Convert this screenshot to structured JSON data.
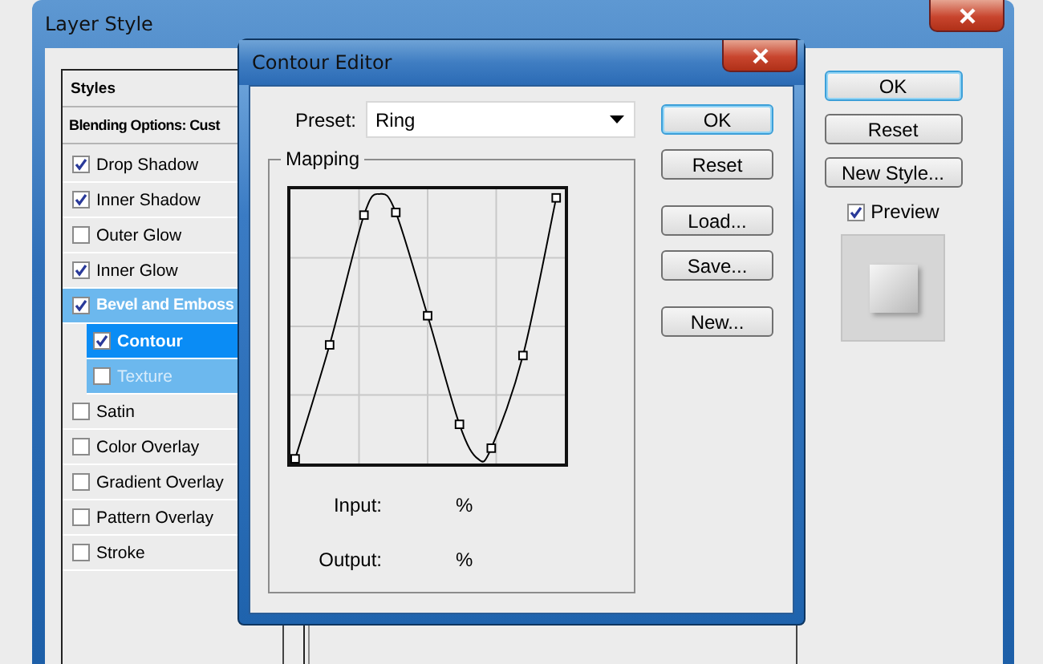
{
  "layer_style": {
    "title": "Layer Style",
    "styles_header": "Styles",
    "blending_options": "Blending Options: Cust",
    "effects": [
      {
        "label": "Drop Shadow",
        "checked": true,
        "selected": false
      },
      {
        "label": "Inner Shadow",
        "checked": true,
        "selected": false
      },
      {
        "label": "Outer Glow",
        "checked": false,
        "selected": false
      },
      {
        "label": "Inner Glow",
        "checked": true,
        "selected": false
      },
      {
        "label": "Bevel and Emboss",
        "checked": true,
        "selected": false,
        "expanded": true,
        "children": [
          {
            "label": "Contour",
            "checked": true,
            "selected": true
          },
          {
            "label": "Texture",
            "checked": false,
            "selected": false
          }
        ]
      },
      {
        "label": "Satin",
        "checked": false,
        "selected": false
      },
      {
        "label": "Color Overlay",
        "checked": false,
        "selected": false
      },
      {
        "label": "Gradient Overlay",
        "checked": false,
        "selected": false
      },
      {
        "label": "Pattern Overlay",
        "checked": false,
        "selected": false
      },
      {
        "label": "Stroke",
        "checked": false,
        "selected": false
      }
    ],
    "buttons": [
      {
        "label": "OK",
        "default": true
      },
      {
        "label": "Reset",
        "default": false
      },
      {
        "label": "New Style...",
        "default": false
      }
    ],
    "preview": {
      "label": "Preview",
      "checked": true
    }
  },
  "contour_editor": {
    "title": "Contour Editor",
    "preset_label": "Preset:",
    "preset_value": "Ring",
    "mapping_label": "Mapping",
    "input_label": "Input:",
    "input_unit": "%",
    "output_label": "Output:",
    "output_unit": "%",
    "buttons": [
      {
        "label": "OK",
        "default": true
      },
      {
        "label": "Reset",
        "default": false
      },
      {
        "label": "Load...",
        "default": false
      },
      {
        "label": "Save...",
        "default": false
      },
      {
        "label": "New...",
        "default": false
      }
    ]
  }
}
